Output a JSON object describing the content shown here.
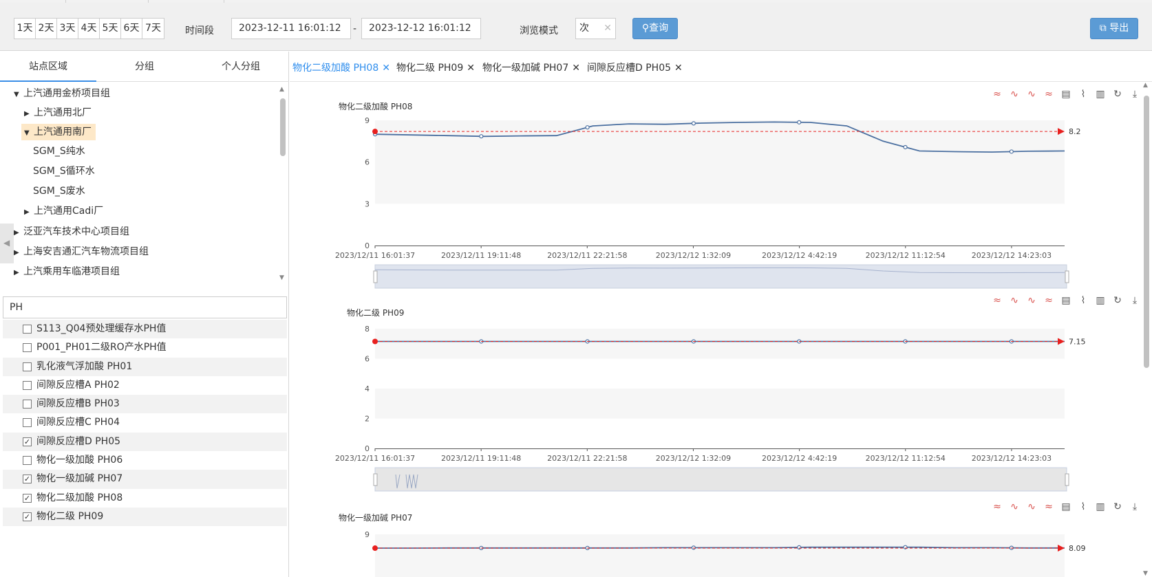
{
  "toolbar": {
    "days": [
      "1天",
      "2天",
      "3天",
      "4天",
      "5天",
      "6天",
      "7天"
    ],
    "time_label": "时间段",
    "start_time": "2023-12-11 16:01:12",
    "end_time": "2023-12-12 16:01:12",
    "separator": "-",
    "mode_label": "浏览模式",
    "mode_value": "次",
    "query_label": "查询",
    "export_label": "导出"
  },
  "left": {
    "tabs": [
      "站点区域",
      "分组",
      "个人分组"
    ],
    "tree": [
      {
        "label": "上汽通用金桥项目组",
        "arrow": "▼"
      },
      {
        "label": "上汽通用北厂",
        "arrow": "▶"
      },
      {
        "label": "上汽通用南厂",
        "arrow": "▼"
      },
      {
        "label": "SGM_S纯水",
        "arrow": ""
      },
      {
        "label": "SGM_S循环水",
        "arrow": ""
      },
      {
        "label": "SGM_S废水",
        "arrow": ""
      },
      {
        "label": "上汽通用Cadi厂",
        "arrow": "▶"
      },
      {
        "label": "泛亚汽车技术中心项目组",
        "arrow": "▶"
      },
      {
        "label": "上海安吉通汇汽车物流项目组",
        "arrow": "▶"
      },
      {
        "label": "上汽乘用车临港项目组",
        "arrow": "▶"
      }
    ],
    "search_value": "PH",
    "params": [
      {
        "label": "S113_Q04预处理缓存水PH值",
        "checked": false
      },
      {
        "label": "P001_PH01二级RO产水PH值",
        "checked": false
      },
      {
        "label": "乳化液气浮加酸 PH01",
        "checked": false
      },
      {
        "label": "间隙反应槽A PH02",
        "checked": false
      },
      {
        "label": "间隙反应槽B PH03",
        "checked": false
      },
      {
        "label": "间隙反应槽C PH04",
        "checked": false
      },
      {
        "label": "间隙反应槽D PH05",
        "checked": true
      },
      {
        "label": "物化一级加酸 PH06",
        "checked": false
      },
      {
        "label": "物化一级加碱 PH07",
        "checked": true
      },
      {
        "label": "物化二级加酸 PH08",
        "checked": true
      },
      {
        "label": "物化二级 PH09",
        "checked": true
      }
    ]
  },
  "right": {
    "tabs": [
      {
        "label": "物化二级加酸 PH08",
        "close": "✕",
        "active": true
      },
      {
        "label": "物化二级 PH09",
        "close": "✕",
        "active": false
      },
      {
        "label": "物化一级加碱 PH07",
        "close": "✕",
        "active": false
      },
      {
        "label": "间隙反应槽D PH05",
        "close": "✕",
        "active": false
      }
    ]
  },
  "chart_data": [
    {
      "type": "line",
      "title": "物化二级加酸 PH08",
      "x_ticks": [
        "2023/12/11 16:01:37",
        "2023/12/11 19:11:48",
        "2023/12/11 22:21:58",
        "2023/12/12 1:32:09",
        "2023/12/12 4:42:19",
        "2023/12/12 11:12:54",
        "2023/12/12 14:23:03"
      ],
      "y_ticks": [
        0,
        3,
        6,
        9
      ],
      "ylim": [
        0,
        9
      ],
      "series": [
        {
          "values": [
            8.0,
            7.95,
            7.9,
            7.85,
            7.88,
            7.9,
            8.6,
            8.75,
            8.72,
            8.8,
            8.85,
            8.88,
            8.85,
            8.6,
            7.5,
            6.8,
            6.75,
            6.72,
            6.78,
            6.8
          ]
        }
      ],
      "markers": [
        0,
        0.154,
        0.308,
        0.462,
        0.615,
        0.769,
        0.923
      ],
      "threshold": {
        "value": 8.2,
        "label": "8.2"
      },
      "line_color": "#4a6fa0",
      "threshold_color": "#e8201f"
    },
    {
      "type": "line",
      "title": "物化二级 PH09",
      "x_ticks": [
        "2023/12/11 16:01:37",
        "2023/12/11 19:11:48",
        "2023/12/11 22:21:58",
        "2023/12/12 1:32:09",
        "2023/12/12 4:42:19",
        "2023/12/12 11:12:54",
        "2023/12/12 14:23:03"
      ],
      "y_ticks": [
        0,
        2,
        4,
        6,
        8
      ],
      "ylim": [
        0,
        8
      ],
      "series": [
        {
          "values": [
            7.15,
            7.15,
            7.15,
            7.15,
            7.15,
            7.15,
            7.15,
            7.15,
            7.15,
            7.15,
            7.15,
            7.15,
            7.15,
            7.15,
            7.15,
            7.15,
            7.15,
            7.15,
            7.15,
            7.15
          ]
        }
      ],
      "markers": [
        0,
        0.154,
        0.308,
        0.462,
        0.615,
        0.769,
        0.923
      ],
      "threshold": {
        "value": 7.15,
        "label": "7.15"
      },
      "line_color": "#4a6fa0",
      "threshold_color": "#e8201f"
    },
    {
      "type": "line",
      "title": "物化一级加碱 PH07",
      "x_ticks": [],
      "y_ticks": [
        9
      ],
      "ylim": [
        0,
        9
      ],
      "series": [
        {
          "values": [
            8.09,
            8.09,
            8.1,
            8.1,
            8.1,
            8.1,
            8.1,
            8.1,
            8.12,
            8.12,
            8.12,
            8.12,
            8.15,
            8.15,
            8.15,
            8.15,
            8.12,
            8.12,
            8.1,
            8.1
          ]
        }
      ],
      "markers": [
        0,
        0.154,
        0.308,
        0.462,
        0.615,
        0.769,
        0.923
      ],
      "threshold": {
        "value": 8.09,
        "label": "8.09"
      },
      "line_color": "#4a6fa0",
      "threshold_color": "#e8201f"
    }
  ],
  "chart_tools": [
    "≈",
    "∿",
    "∿",
    "≈",
    "▤",
    "⌇",
    "▥",
    "↻",
    "⤓"
  ]
}
